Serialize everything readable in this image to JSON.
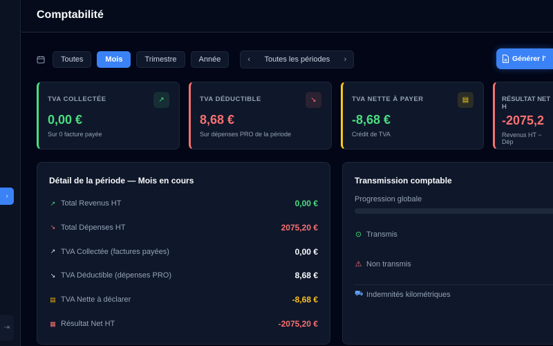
{
  "header": {
    "title": "Comptabilité"
  },
  "filters": {
    "options": [
      {
        "label": "Toutes",
        "active": false
      },
      {
        "label": "Mois",
        "active": true
      },
      {
        "label": "Trimestre",
        "active": false
      },
      {
        "label": "Année",
        "active": false
      }
    ],
    "period": "Toutes les périodes"
  },
  "actions": {
    "generate_label": "Générer l'"
  },
  "colors": {
    "accent": "#3b82f6",
    "green": "#4ade80",
    "red": "#f87171",
    "yellow": "#facc15"
  },
  "cards": [
    {
      "label": "TVA COLLECTÉE",
      "value": "0,00 €",
      "sub": "Sur 0 facture payée",
      "icon": "trending-up-icon",
      "color": "#4ade80"
    },
    {
      "label": "TVA DÉDUCTIBLE",
      "value": "8,68 €",
      "sub": "Sur dépenses PRO de la période",
      "icon": "trending-down-icon",
      "color": "#f87171"
    },
    {
      "label": "TVA NETTE À PAYER",
      "value": "-8,68 €",
      "sub": "Crédit de TVA",
      "icon": "receipt-icon",
      "color": "#facc15",
      "value_color": "#4ade80"
    },
    {
      "label": "RÉSULTAT NET H",
      "value": "-2075,2",
      "sub": "Revenus HT − Dép",
      "icon": "calculator-icon",
      "color": "#f87171"
    }
  ],
  "detail": {
    "title": "Détail de la période — Mois en cours",
    "rows": [
      {
        "label": "Total Revenus HT",
        "value": "0,00 €",
        "icon": "trending-up-icon",
        "color": "#4ade80",
        "icolor": "#4ade80"
      },
      {
        "label": "Total Dépenses HT",
        "value": "2075,20 €",
        "icon": "trending-down-icon",
        "color": "#f87171",
        "icolor": "#f87171"
      },
      {
        "label": "TVA Collectée (factures payées)",
        "value": "0,00 €",
        "icon": "trending-up-icon",
        "color": "#f8fafc",
        "icolor": "#e2e8f0"
      },
      {
        "label": "TVA Déductible (dépenses PRO)",
        "value": "8,68 €",
        "icon": "trending-down-icon",
        "color": "#f8fafc",
        "icolor": "#e2e8f0"
      },
      {
        "label": "TVA Nette à déclarer",
        "value": "-8,68 €",
        "icon": "receipt-icon",
        "color": "#fbbf24",
        "icolor": "#eab308"
      },
      {
        "label": "Résultat Net HT",
        "value": "-2075,20 €",
        "icon": "calculator-icon",
        "color": "#f87171",
        "icolor": "#f87171"
      }
    ]
  },
  "transmission": {
    "title": "Transmission comptable",
    "progress_label": "Progression globale",
    "progress": 0,
    "items": [
      {
        "label": "Transmis",
        "icon": "check-circle-icon"
      },
      {
        "label": "Non transmis",
        "icon": "warning-icon"
      },
      {
        "label": "Indemnités kilométriques",
        "icon": "car-icon"
      }
    ]
  }
}
